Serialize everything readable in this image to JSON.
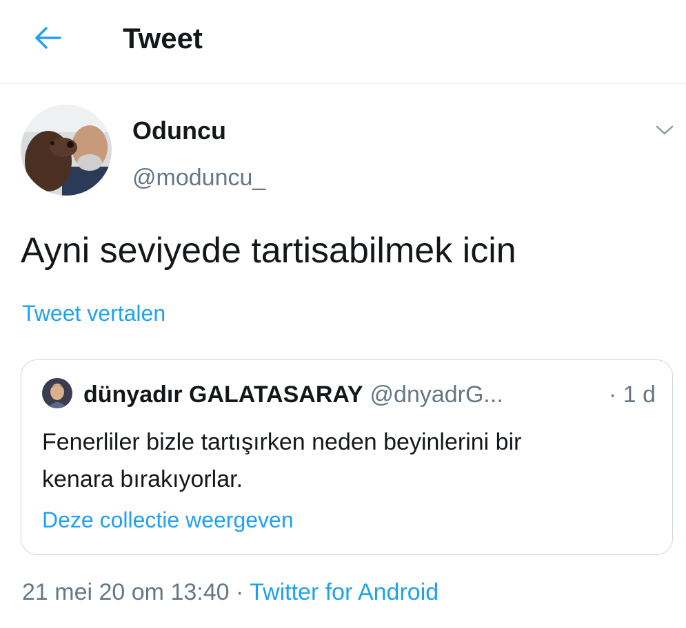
{
  "header": {
    "title": "Tweet",
    "back_icon": "arrow-left-icon"
  },
  "tweet": {
    "author_name": "Oduncu",
    "author_handle": "@moduncu_",
    "menu_icon": "chevron-down-icon",
    "text": "Ayni seviyede tartisabilmek icin",
    "translate_label": "Tweet vertalen",
    "date": "21 mei 20 om 13:40",
    "separator": "·",
    "source": "Twitter for Android"
  },
  "quote": {
    "author_name": "dünyadır GALATASARAY",
    "author_handle": "@dnyadrG...",
    "time": "· 1 d",
    "text": "Fenerliler bizle tartışırken neden beyinlerini bir\nkenara  bırakıyorlar.",
    "collection_link": "Deze collectie weergeven"
  },
  "colors": {
    "accent": "#1da1f2",
    "text": "#14171a",
    "secondary": "#657786",
    "border": "#ccd6dd"
  }
}
